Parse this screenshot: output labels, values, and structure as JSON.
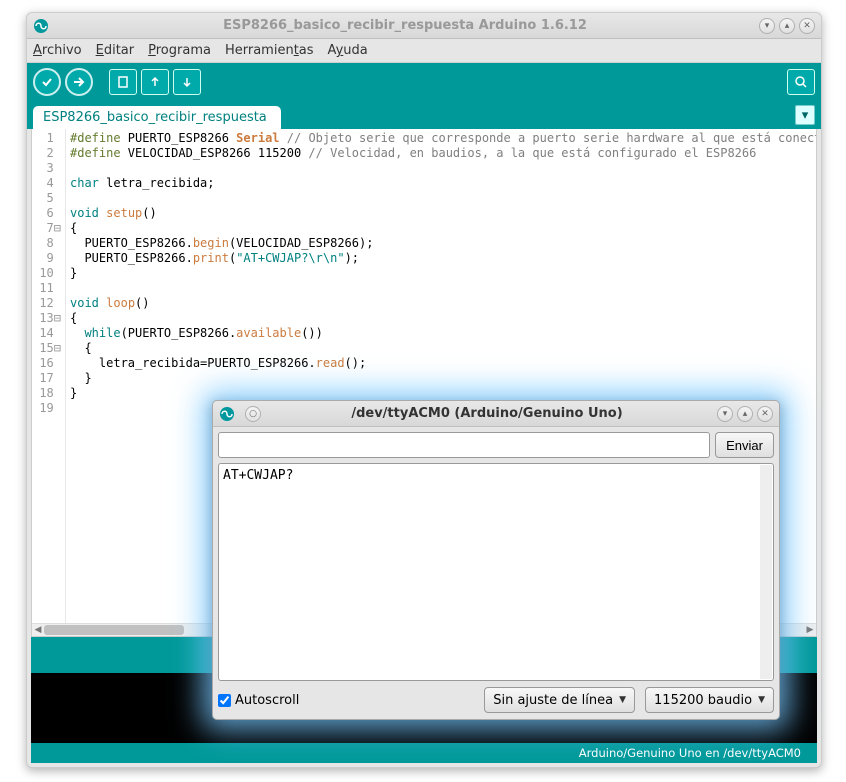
{
  "main_window": {
    "title": "ESP8266_basico_recibir_respuesta Arduino 1.6.12"
  },
  "menubar": {
    "items": [
      "Archivo",
      "Editar",
      "Programa",
      "Herramientas",
      "Ayuda"
    ],
    "underline": [
      0,
      0,
      0,
      10,
      1
    ]
  },
  "toolbar": {
    "verify": "✓",
    "upload": "→",
    "new": "▦",
    "open": "↑",
    "save": "↓",
    "serial": "🔍"
  },
  "tab": {
    "name": "ESP8266_basico_recibir_respuesta"
  },
  "code": {
    "lines": [
      {
        "n": "1",
        "fold": "",
        "html": "<span class='kw-def'>#define</span> PUERTO_ESP8266 <span class='kw-obj'>Serial</span> <span class='cmt'>// Objeto serie que corresponde a puerto serie hardware al que está conectad</span>"
      },
      {
        "n": "2",
        "fold": "",
        "html": "<span class='kw-def'>#define</span> VELOCIDAD_ESP8266 115200 <span class='cmt'>// Velocidad, en baudios, a la que está configurado el ESP8266</span>"
      },
      {
        "n": "3",
        "fold": "",
        "html": ""
      },
      {
        "n": "4",
        "fold": "",
        "html": "<span class='kw-type'>char</span> letra_recibida;"
      },
      {
        "n": "5",
        "fold": "",
        "html": ""
      },
      {
        "n": "6",
        "fold": "",
        "html": "<span class='kw-type'>void</span> <span class='func'>setup</span>()"
      },
      {
        "n": "7",
        "fold": "⊟",
        "html": "{"
      },
      {
        "n": "8",
        "fold": "",
        "html": "  PUERTO_ESP8266.<span class='func'>begin</span>(VELOCIDAD_ESP8266);"
      },
      {
        "n": "9",
        "fold": "",
        "html": "  PUERTO_ESP8266.<span class='func'>print</span>(<span class='str'>\"AT+CWJAP?\\r\\n\"</span>);"
      },
      {
        "n": "10",
        "fold": "",
        "html": "}"
      },
      {
        "n": "11",
        "fold": "",
        "html": ""
      },
      {
        "n": "12",
        "fold": "",
        "html": "<span class='kw-type'>void</span> <span class='func'>loop</span>()"
      },
      {
        "n": "13",
        "fold": "⊟",
        "html": "{"
      },
      {
        "n": "14",
        "fold": "",
        "html": "  <span class='kw-type'>while</span>(PUERTO_ESP8266.<span class='func'>available</span>())"
      },
      {
        "n": "15",
        "fold": "⊟",
        "html": "  {"
      },
      {
        "n": "16",
        "fold": "",
        "html": "    letra_recibida=PUERTO_ESP8266.<span class='func'>read</span>();"
      },
      {
        "n": "17",
        "fold": "",
        "html": "  }"
      },
      {
        "n": "18",
        "fold": "",
        "html": "}"
      },
      {
        "n": "19",
        "fold": "",
        "html": ""
      }
    ]
  },
  "footer": {
    "text": "Arduino/Genuino Uno en /dev/ttyACM0"
  },
  "serial": {
    "title": "/dev/ttyACM0 (Arduino/Genuino Uno)",
    "input_value": "",
    "send_label": "Enviar",
    "output": "AT+CWJAP?",
    "autoscroll_label": "Autoscroll",
    "autoscroll_checked": true,
    "line_ending": "Sin ajuste de línea",
    "baud": "115200 baudio"
  }
}
